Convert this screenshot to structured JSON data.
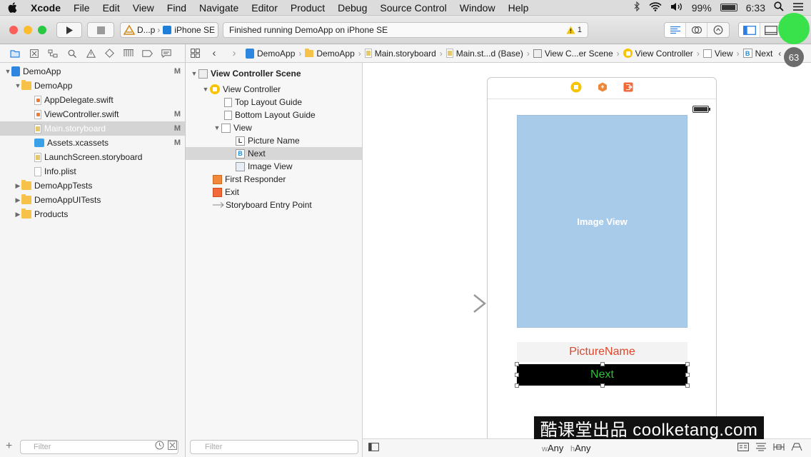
{
  "menubar": {
    "app_name": "Xcode",
    "items": [
      "File",
      "Edit",
      "View",
      "Find",
      "Navigate",
      "Editor",
      "Product",
      "Debug",
      "Source Control",
      "Window",
      "Help"
    ],
    "battery_percent": "99%",
    "time": "6:33"
  },
  "toolbar": {
    "scheme_name": "D...p",
    "device_name": "iPhone SE",
    "activity_text": "Finished running DemoApp on iPhone SE",
    "warning_count": "1",
    "colors": {
      "close": "#fc5f57",
      "minimize": "#fdbc2e",
      "zoom": "#28c840"
    }
  },
  "navigator": {
    "tree": [
      {
        "label": "DemoApp",
        "badge": "M",
        "type": "project"
      },
      {
        "label": "DemoApp",
        "badge": "",
        "type": "folder"
      },
      {
        "label": "AppDelegate.swift",
        "badge": "",
        "type": "swift"
      },
      {
        "label": "ViewController.swift",
        "badge": "M",
        "type": "swift"
      },
      {
        "label": "Main.storyboard",
        "badge": "M",
        "type": "storyboard"
      },
      {
        "label": "Assets.xcassets",
        "badge": "M",
        "type": "assets"
      },
      {
        "label": "LaunchScreen.storyboard",
        "badge": "",
        "type": "storyboard"
      },
      {
        "label": "Info.plist",
        "badge": "",
        "type": "plist"
      },
      {
        "label": "DemoAppTests",
        "badge": "",
        "type": "folder"
      },
      {
        "label": "DemoAppUITests",
        "badge": "",
        "type": "folder"
      },
      {
        "label": "Products",
        "badge": "",
        "type": "folder"
      }
    ],
    "filter_placeholder": "Filter"
  },
  "jumpbar": {
    "crumbs": [
      "DemoApp",
      "DemoApp",
      "Main.storyboard",
      "Main.st...d (Base)",
      "View C...er Scene",
      "View Controller",
      "View",
      "Next"
    ]
  },
  "outline": {
    "rows": [
      {
        "label": "View Controller Scene"
      },
      {
        "label": "View Controller"
      },
      {
        "label": "Top Layout Guide"
      },
      {
        "label": "Bottom Layout Guide"
      },
      {
        "label": "View"
      },
      {
        "label": "Picture Name",
        "letter": "L"
      },
      {
        "label": "Next",
        "letter": "B"
      },
      {
        "label": "Image View"
      },
      {
        "label": "First Responder"
      },
      {
        "label": "Exit"
      },
      {
        "label": "Storyboard Entry Point"
      }
    ],
    "filter_placeholder": "Filter"
  },
  "canvas": {
    "image_view_label": "Image View",
    "picture_name_label": "PictureName",
    "next_button_label": "Next",
    "size_class_w_prefix": "w",
    "size_class_w": "Any",
    "size_class_h_prefix": "h",
    "size_class_h": "Any",
    "colors": {
      "image_view": "#a9cbea",
      "picture_name_text": "#e0452a",
      "next_text": "#2fbf3b",
      "next_bg": "#000000"
    }
  },
  "overlay": {
    "watermark": "酷课堂出品 coolketang.com",
    "step_counter": "63"
  }
}
